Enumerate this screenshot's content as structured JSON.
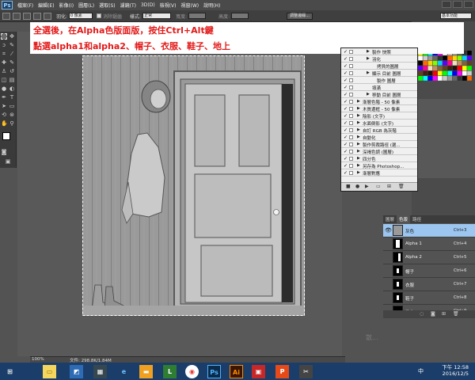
{
  "app": {
    "logo": "Ps",
    "menus": [
      "檔案(F)",
      "編輯(E)",
      "影像(I)",
      "圖層(L)",
      "選取(S)",
      "濾鏡(T)",
      "3D(D)",
      "檢視(V)",
      "視窗(W)",
      "說明(H)"
    ]
  },
  "options_bar": {
    "feather_label": "羽化:",
    "feather_value": "0 像素",
    "antialias_label": "消除鋸齒",
    "style_label": "樣式:",
    "style_value": "正常",
    "width_label": "寬度:",
    "height_label": "高度:",
    "refine_edge_button": "調整邊緣...",
    "workspace": "基本功能"
  },
  "annotation": {
    "line1": "全選後，在Alpha色版面版，按住Ctrl+Alt鍵",
    "line2": "點選alpha1和alpha2、帽子、衣服、鞋子、地上"
  },
  "actions_panel": {
    "rows": [
      {
        "check": "✓",
        "indent": 2,
        "expand": "▶",
        "label": "製作 快照"
      },
      {
        "check": "✓",
        "indent": 2,
        "expand": "▶",
        "label": "羽化"
      },
      {
        "check": "✓",
        "indent": 3,
        "expand": "",
        "label": "拷貝的圖層"
      },
      {
        "check": "✓",
        "indent": 2,
        "expand": "▶",
        "label": "顯示 目前 圖層"
      },
      {
        "check": "✓",
        "indent": 3,
        "expand": "",
        "label": "製作 圖層"
      },
      {
        "check": "✓",
        "indent": 2,
        "expand": "",
        "label": "填滿"
      },
      {
        "check": "✓",
        "indent": 2,
        "expand": "▶",
        "label": "移動 目前 圖層"
      },
      {
        "check": "✓",
        "indent": 0,
        "expand": "▶",
        "label": "漸層色階 - 50 像素"
      },
      {
        "check": "✓",
        "indent": 0,
        "expand": "▶",
        "label": "木質邊框 - 50 像素"
      },
      {
        "check": "✓",
        "indent": 0,
        "expand": "▶",
        "label": "陰影 (文字)"
      },
      {
        "check": "✓",
        "indent": 0,
        "expand": "▶",
        "label": "水面倒影 (文字)"
      },
      {
        "check": "✓",
        "indent": 0,
        "expand": "▶",
        "label": "自訂 RGB 為灰階"
      },
      {
        "check": "✓",
        "indent": 0,
        "expand": "▶",
        "label": "自動化"
      },
      {
        "check": "✓",
        "indent": 0,
        "expand": "▶",
        "label": "製作剪裁路徑 (選..."
      },
      {
        "check": "✓",
        "indent": 0,
        "expand": "▶",
        "label": "深褐色調 (圖層)"
      },
      {
        "check": "✓",
        "indent": 0,
        "expand": "▶",
        "label": "四分色"
      },
      {
        "check": "✓",
        "indent": 0,
        "expand": "▶",
        "label": "另存為 Photoshop..."
      },
      {
        "check": "✓",
        "indent": 0,
        "expand": "▶",
        "label": "漸層對應"
      }
    ]
  },
  "channels_panel": {
    "tabs": [
      "圖層",
      "色版",
      "路徑"
    ],
    "active_tab": 1,
    "channels": [
      {
        "name": "灰色",
        "shortcut": "Ctrl+3",
        "selected": true,
        "visible": true,
        "thumb": "photo"
      },
      {
        "name": "Alpha 1",
        "shortcut": "Ctrl+4",
        "selected": false,
        "visible": false,
        "thumb": "alpha1"
      },
      {
        "name": "Alpha 2",
        "shortcut": "Ctrl+5",
        "selected": false,
        "visible": false,
        "thumb": "alpha2"
      },
      {
        "name": "帽子",
        "shortcut": "Ctrl+6",
        "selected": false,
        "visible": false,
        "thumb": "hat"
      },
      {
        "name": "衣服",
        "shortcut": "Ctrl+7",
        "selected": false,
        "visible": false,
        "thumb": "cloth"
      },
      {
        "name": "鞋子",
        "shortcut": "Ctrl+8",
        "selected": false,
        "visible": false,
        "thumb": "shoe"
      },
      {
        "name": "地上",
        "shortcut": "Ctrl+9",
        "selected": false,
        "visible": false,
        "thumb": "floor"
      }
    ]
  },
  "status_bar": {
    "zoom": "100%",
    "doc_info": "文件: 298.8K/1.84M"
  },
  "taskbar": {
    "time": "下午 12:58",
    "date": "2016/12/5",
    "ime": "中"
  },
  "watermark": "散..."
}
